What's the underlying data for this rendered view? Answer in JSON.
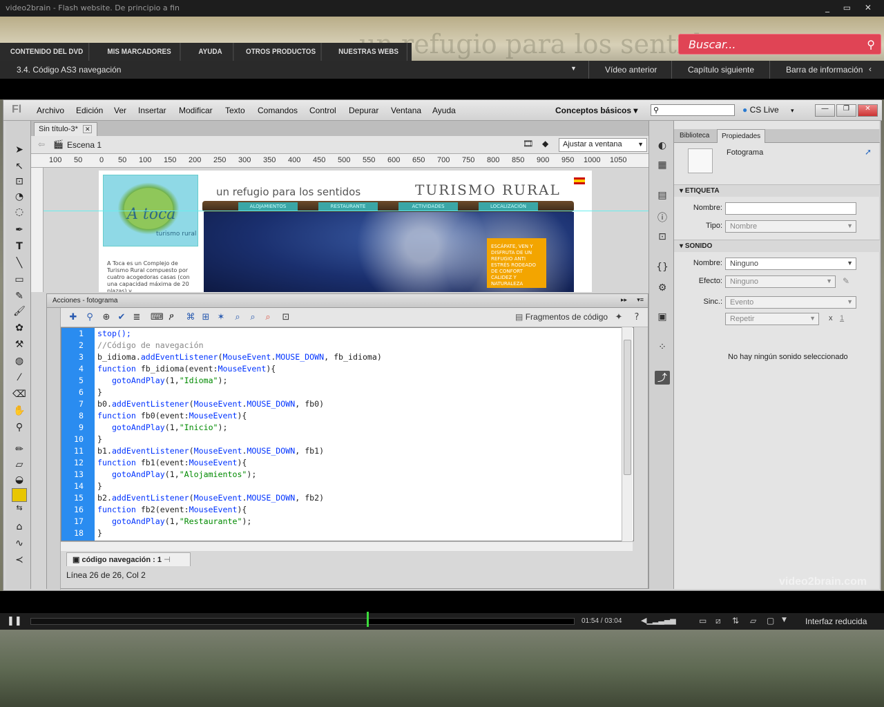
{
  "window": {
    "title": "video2brain - Flash website. De principio a fin",
    "controls": "_ ▭ ✕"
  },
  "banner": {
    "bg_text": "un refugio para los sentidos"
  },
  "nav": {
    "tabs": [
      "CONTENIDO DEL DVD",
      "MIS MARCADORES",
      "AYUDA",
      "OTROS PRODUCTOS",
      "NUESTRAS WEBS"
    ]
  },
  "search": {
    "placeholder": "Buscar..."
  },
  "chapter": {
    "title": "3.4. Código AS3 navegación",
    "prev": "Vídeo anterior",
    "next": "Capítulo siguiente",
    "infobar": "Barra de información"
  },
  "menubar": {
    "items": [
      "Archivo",
      "Edición",
      "Ver",
      "Insertar",
      "Modificar",
      "Texto",
      "Comandos",
      "Control",
      "Depurar",
      "Ventana",
      "Ayuda"
    ],
    "workspace": "Conceptos básicos",
    "cslive": "CS Live"
  },
  "document": {
    "tab": "Sin título-3*",
    "scene": "Escena 1",
    "zoom": "Ajustar a ventana"
  },
  "ruler": {
    "ticks": [
      "100",
      "50",
      "0",
      "50",
      "100",
      "150",
      "200",
      "250",
      "300",
      "350",
      "400",
      "450",
      "500",
      "550",
      "600",
      "650",
      "700",
      "750",
      "800",
      "850",
      "900",
      "950",
      "1000",
      "1050"
    ]
  },
  "site": {
    "logo": "A toca",
    "logo_sub": "turismo rural",
    "slogan": "un refugio para los sentidos",
    "brand": "TURISMO RURAL",
    "nav": [
      "ALOJAMIENTOS",
      "RESTAURANTE",
      "ACTIVIDADES",
      "LOCALIZACIÓN"
    ],
    "promo": "ESCÁPATE, VEN Y DISFRUTA DE UN REFUGIO ANTI ESTRÉS RODEADO DE CONFORT CALIDEZ Y NATURALEZA",
    "body": "A Toca es un Complejo de Turismo Rural compuesto por cuatro acogedoras casas (con una capacidad máxima de 20 plazas) y"
  },
  "actions": {
    "title": "Acciones - fotograma",
    "fragments": "Fragmentos de código",
    "code": [
      "stop();",
      "//Código de navegación",
      "b_idioma.addEventListener(MouseEvent.MOUSE_DOWN, fb_idioma)",
      "function fb_idioma(event:MouseEvent){",
      "   gotoAndPlay(1,\"Idioma\");",
      "}",
      "b0.addEventListener(MouseEvent.MOUSE_DOWN, fb0)",
      "function fb0(event:MouseEvent){",
      "   gotoAndPlay(1,\"Inicio\");",
      "}",
      "b1.addEventListener(MouseEvent.MOUSE_DOWN, fb1)",
      "function fb1(event:MouseEvent){",
      "   gotoAndPlay(1,\"Alojamientos\");",
      "}",
      "b2.addEventListener(MouseEvent.MOUSE_DOWN, fb2)",
      "function fb2(event:MouseEvent){",
      "   gotoAndPlay(1,\"Restaurante\");",
      "}"
    ],
    "script_tab": "código navegación : 1",
    "status": "Línea 26 de 26, Col 2"
  },
  "props": {
    "tabs": [
      "Biblioteca",
      "Propiedades"
    ],
    "object": "Fotograma",
    "section_label": "ETIQUETA",
    "label_name": "Nombre:",
    "label_name_value": "",
    "label_type": "Tipo:",
    "label_type_value": "Nombre",
    "section_sound": "SONIDO",
    "sound_name": "Nombre:",
    "sound_name_value": "Ninguno",
    "effect": "Efecto:",
    "effect_value": "Ninguno",
    "sync": "Sinc.:",
    "sync_value": "Evento",
    "repeat_value": "Repetir",
    "repeat_x": "x",
    "repeat_count": "1",
    "no_sound": "No hay ningún sonido seleccionado"
  },
  "video": {
    "time": "01:54 / 03:04",
    "progress": 0.62,
    "reduced": "Interfaz reducida",
    "watermark": "video2brain.com"
  },
  "colors": {
    "accent": "#2a8cf0",
    "search": "#e04455",
    "playhead": "#3cdc3c"
  }
}
